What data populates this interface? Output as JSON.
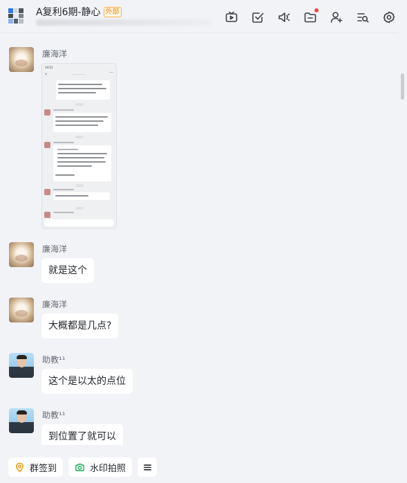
{
  "header": {
    "title": "A复利6期-静心",
    "external_badge": "外部",
    "toolbar": {
      "icons": [
        "tv-icon",
        "task-check-icon",
        "announcement-icon",
        "folder-icon",
        "add-member-icon",
        "search-history-icon",
        "settings-icon"
      ],
      "folder_has_notification": true
    }
  },
  "messages": [
    {
      "sender": "廉海洋",
      "type": "image",
      "image_description": "phone screenshot of chat"
    },
    {
      "sender": "廉海洋",
      "type": "text",
      "text": "就是这个"
    },
    {
      "sender": "廉海洋",
      "type": "text",
      "text": "大概都是几点?"
    },
    {
      "sender": "助教¹¹",
      "type": "text",
      "text": "这个是以太的点位"
    },
    {
      "sender": "助教¹¹",
      "type": "text",
      "text": "到位置了就可以"
    }
  ],
  "bottom_bar": {
    "checkin_label": "群签到",
    "watermark_label": "水印拍照"
  },
  "colors": {
    "background": "#f2f3f7",
    "bubble": "#ffffff",
    "badge": "#e58a00",
    "checkin_icon": "#f0a020",
    "camera_icon": "#2db46c",
    "notification_dot": "#f54a45"
  }
}
